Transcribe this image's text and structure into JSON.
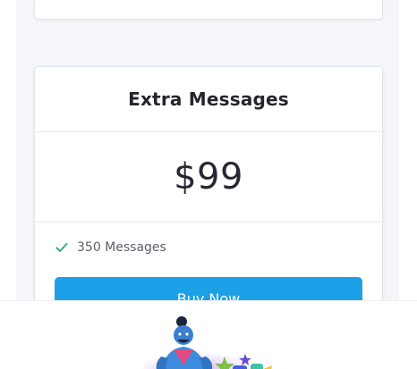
{
  "plan_card": {
    "title": "Extra Messages",
    "price": "$99",
    "features": [
      {
        "label": "350 Messages",
        "icon": "check-icon"
      }
    ],
    "buy_label": "Buy Now"
  },
  "colors": {
    "accent": "#1da1e6",
    "check": "#2fb37a",
    "title": "#24262b",
    "background": "#f4f6fa"
  },
  "mascot": {
    "icon": "genie-mascot-icon"
  }
}
